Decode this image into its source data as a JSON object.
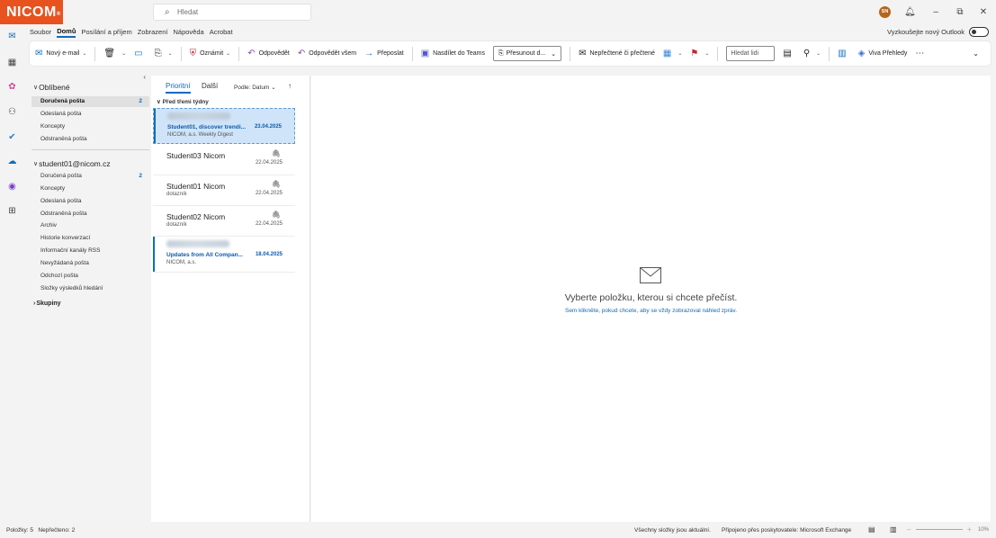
{
  "app": {
    "logo": "NICOM",
    "logo_mark": "®",
    "search_placeholder": "Hledat",
    "avatar_initials": "SN"
  },
  "menu_tabs": [
    "Soubor",
    "Domů",
    "Posílání a příjem",
    "Zobrazení",
    "Nápověda",
    "Acrobat"
  ],
  "try_new_outlook": "Vyzkoušejte nový Outlook",
  "ribbon": {
    "new_email": "Nový e-mail",
    "announce": "Oznámit",
    "reply": "Odpovědět",
    "reply_all": "Odpovědět všem",
    "forward": "Přeposlat",
    "share_teams": "Nasdílet do Teams",
    "move": "Přesunout d...",
    "unread_read": "Nepřečtené či přečtené",
    "find_people": "Hledat lidi",
    "viva": "Viva Přehledy"
  },
  "favorites": {
    "title": "Oblíbené",
    "items": [
      {
        "label": "Doručená pošta",
        "count": "2"
      },
      {
        "label": "Odeslaná pošta",
        "count": ""
      },
      {
        "label": "Koncepty",
        "count": ""
      },
      {
        "label": "Odstraněná pošta",
        "count": ""
      }
    ]
  },
  "account": {
    "title": "student01@nicom.cz",
    "items": [
      {
        "label": "Doručená pošta",
        "count": "2"
      },
      {
        "label": "Koncepty",
        "count": ""
      },
      {
        "label": "Odeslaná pošta",
        "count": ""
      },
      {
        "label": "Odstraněná pošta",
        "count": ""
      },
      {
        "label": "Archiv",
        "count": ""
      },
      {
        "label": "Historie konverzací",
        "count": ""
      },
      {
        "label": "Informační kanály RSS",
        "count": ""
      },
      {
        "label": "Nevyžádaná pošta",
        "count": ""
      },
      {
        "label": "Odchozí pošta",
        "count": ""
      },
      {
        "label": "Složky výsledků hledání",
        "count": ""
      }
    ]
  },
  "groups_label": "Skupiny",
  "message_list": {
    "tab_focused": "Prioritní",
    "tab_other": "Další",
    "sort_label": "Podle: Datum",
    "group_label": "Před třemi týdny",
    "messages": [
      {
        "sender": "",
        "subject": "Student01, discover trendi...",
        "preview": "NICOM, a.s. Weekly Digest",
        "date": "23.04.2025"
      },
      {
        "sender": "Student03 Nicom",
        "subject": "",
        "preview": "",
        "date": "22.04.2025"
      },
      {
        "sender": "Student01 Nicom",
        "subject": "",
        "preview": "dotazník",
        "date": "22.04.2025"
      },
      {
        "sender": "Student02 Nicom",
        "subject": "",
        "preview": "dotazník",
        "date": "22.04.2025"
      },
      {
        "sender": "",
        "subject": "Updates from All Compan...",
        "preview": "NICOM, a.s.",
        "date": "18.04.2025"
      }
    ]
  },
  "reading_pane": {
    "title": "Vyberte položku, kterou si chcete přečíst.",
    "link": "Sem klikněte, pokud chcete, aby se vždy zobrazoval náhled zpráv."
  },
  "status_bar": {
    "items": "Položky: 5",
    "unread": "Nepřečteno: 2",
    "folders_status": "Všechny složky jsou aktuální.",
    "connection": "Připojeno přes poskytovatele: Microsoft Exchange",
    "zoom": "10%"
  },
  "colors": {
    "brand": "#e8521f",
    "accent": "#0f6cbd",
    "selected_row": "#cfe4f9"
  }
}
